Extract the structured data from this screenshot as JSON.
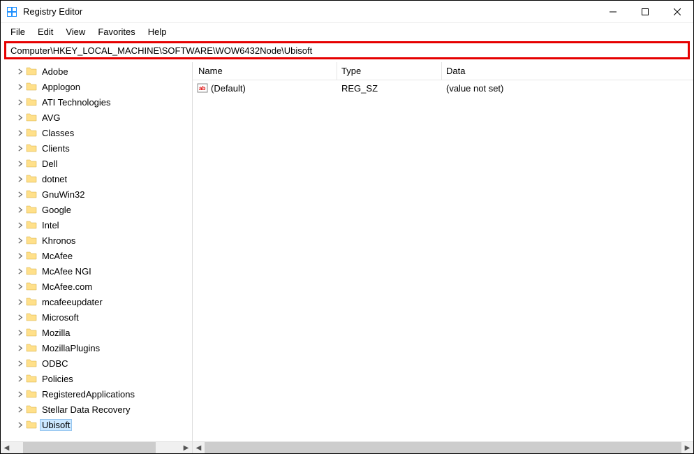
{
  "window": {
    "title": "Registry Editor"
  },
  "menu": {
    "file": "File",
    "edit": "Edit",
    "view": "View",
    "favorites": "Favorites",
    "help": "Help"
  },
  "address": "Computer\\HKEY_LOCAL_MACHINE\\SOFTWARE\\WOW6432Node\\Ubisoft",
  "tree": {
    "items": [
      {
        "label": "Adobe",
        "expandable": true
      },
      {
        "label": "Applogon",
        "expandable": true
      },
      {
        "label": "ATI Technologies",
        "expandable": true
      },
      {
        "label": "AVG",
        "expandable": true
      },
      {
        "label": "Classes",
        "expandable": true
      },
      {
        "label": "Clients",
        "expandable": true
      },
      {
        "label": "Dell",
        "expandable": true
      },
      {
        "label": "dotnet",
        "expandable": true
      },
      {
        "label": "GnuWin32",
        "expandable": true
      },
      {
        "label": "Google",
        "expandable": true
      },
      {
        "label": "Intel",
        "expandable": true
      },
      {
        "label": "Khronos",
        "expandable": true
      },
      {
        "label": "McAfee",
        "expandable": true
      },
      {
        "label": "McAfee NGI",
        "expandable": true
      },
      {
        "label": "McAfee.com",
        "expandable": false
      },
      {
        "label": "mcafeeupdater",
        "expandable": true
      },
      {
        "label": "Microsoft",
        "expandable": true
      },
      {
        "label": "Mozilla",
        "expandable": true
      },
      {
        "label": "MozillaPlugins",
        "expandable": true
      },
      {
        "label": "ODBC",
        "expandable": true
      },
      {
        "label": "Policies",
        "expandable": true
      },
      {
        "label": "RegisteredApplications",
        "expandable": false
      },
      {
        "label": "Stellar Data Recovery",
        "expandable": false
      },
      {
        "label": "Ubisoft",
        "expandable": false,
        "selected": true
      }
    ]
  },
  "values": {
    "headers": {
      "name": "Name",
      "type": "Type",
      "data": "Data"
    },
    "rows": [
      {
        "name": "(Default)",
        "type": "REG_SZ",
        "data": "(value not set)"
      }
    ]
  }
}
